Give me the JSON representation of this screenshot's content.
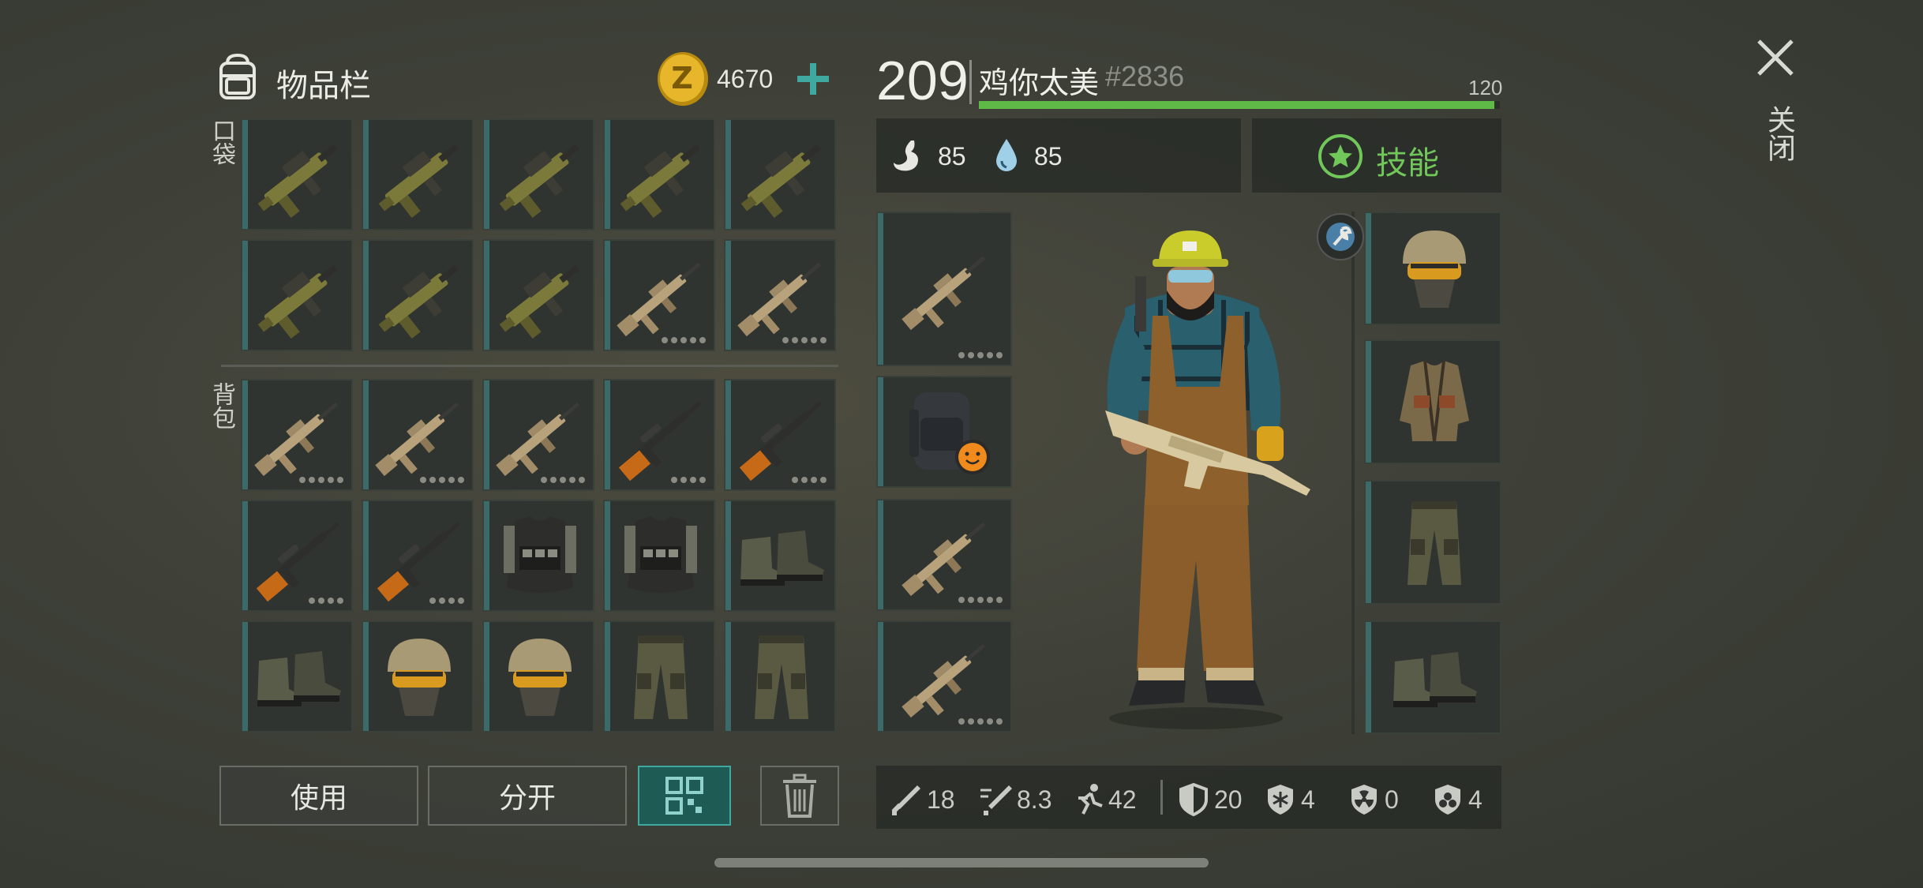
{
  "inventory": {
    "title": "物品栏",
    "currency": "4670",
    "add_label": "+",
    "pocket_label": "口袋",
    "backpack_label": "背包",
    "pocket_items": [
      "grenade-launcher",
      "grenade-launcher",
      "grenade-launcher",
      "grenade-launcher",
      "grenade-launcher",
      "grenade-launcher",
      "grenade-launcher",
      "grenade-launcher",
      "assault-rifle",
      "assault-rifle"
    ],
    "backpack_items": [
      "assault-rifle",
      "assault-rifle",
      "assault-rifle",
      "sniper-rifle",
      "sniper-rifle",
      "sniper-rifle",
      "sniper-rifle",
      "tactical-vest",
      "tactical-vest",
      "boots",
      "boots",
      "helmet",
      "helmet",
      "pants",
      "pants"
    ]
  },
  "buttons": {
    "use": "使用",
    "split": "分开"
  },
  "player": {
    "level": "209",
    "name": "鸡你太美",
    "tag": "#2836",
    "xp_max": "120",
    "xp_fraction": 0.99,
    "hunger": "85",
    "thirst": "85",
    "skills_label": "技能"
  },
  "equipment": {
    "left": [
      "assault-rifle",
      "backpack",
      "assault-rifle",
      "assault-rifle"
    ],
    "right": [
      "helmet",
      "jacket",
      "pants",
      "boots"
    ]
  },
  "stats": {
    "damage": "18",
    "attack_speed": "8.3",
    "movement": "42",
    "armor": "20",
    "cold": "4",
    "radiation": "0",
    "toxic": "4"
  },
  "close_label": "关闭",
  "colors": {
    "accent": "#3fa9a0",
    "xp_bar": "#5fb946",
    "skills": "#72c75a",
    "coin": "#e2b31f"
  }
}
